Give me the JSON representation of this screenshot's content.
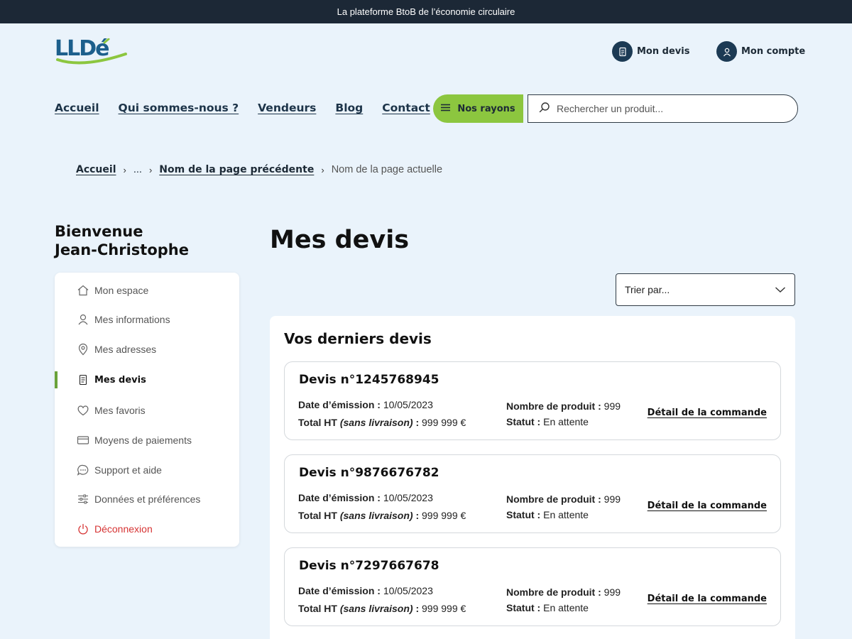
{
  "topbar": {
    "text": "La plateforme BtoB de l’économie circulaire"
  },
  "logo": {
    "text": "LLDé",
    "colors": {
      "blue": "#1c5f8c",
      "green": "#8cc63f"
    }
  },
  "header": {
    "devis_label": "Mon devis",
    "account_label": "Mon compte"
  },
  "nav": [
    "Accueil",
    "Qui sommes-nous ?",
    "Vendeurs",
    "Blog",
    "Contact"
  ],
  "rayons": {
    "label": "Nos rayons"
  },
  "search": {
    "placeholder": "Rechercher un produit..."
  },
  "breadcrumb": {
    "home": "Accueil",
    "ellipsis": "...",
    "previous": "Nom de la page précédente",
    "current": "Nom de la page actuelle"
  },
  "welcome": {
    "line1": "Bienvenue",
    "line2": "Jean-Christophe"
  },
  "sidebar": {
    "items": [
      {
        "label": "Mon espace",
        "icon": "home-icon"
      },
      {
        "label": "Mes informations",
        "icon": "user-icon"
      },
      {
        "label": "Mes adresses",
        "icon": "map-pin-icon"
      },
      {
        "label": "Mes devis",
        "icon": "document-icon",
        "active": true
      },
      {
        "label": "Mes favoris",
        "icon": "heart-icon"
      },
      {
        "label": "Moyens de paiements",
        "icon": "credit-card-icon"
      },
      {
        "label": "Support et aide",
        "icon": "chat-icon"
      },
      {
        "label": "Données et préférences",
        "icon": "sliders-icon"
      },
      {
        "label": "Déconnexion",
        "icon": "power-icon",
        "logout": true
      }
    ]
  },
  "main": {
    "title": "Mes devis",
    "sort_label": "Trier par...",
    "panel_title": "Vos derniers devis",
    "labels": {
      "date": "Date d’émission :",
      "total_prefix": "Total HT",
      "total_note": "(sans livraison)",
      "total_suffix": ":",
      "count": "Nombre de produit :",
      "status": "Statut :",
      "detail": "Détail de la commande"
    },
    "quotes": [
      {
        "title": "Devis n°1245768945",
        "date": "10/05/2023",
        "total": "999 999 €",
        "count": "999",
        "status": "En attente"
      },
      {
        "title": "Devis n°9876676782",
        "date": "10/05/2023",
        "total": "999 999 €",
        "count": "999",
        "status": "En attente"
      },
      {
        "title": "Devis n°7297667678",
        "date": "10/05/2023",
        "total": "999 999 €",
        "count": "999",
        "status": "En attente"
      }
    ]
  },
  "colors": {
    "accent_green": "#8cc63f",
    "dark_navy": "#1c2836",
    "active_bar": "#6aa23a",
    "logout_red": "#d63333"
  }
}
